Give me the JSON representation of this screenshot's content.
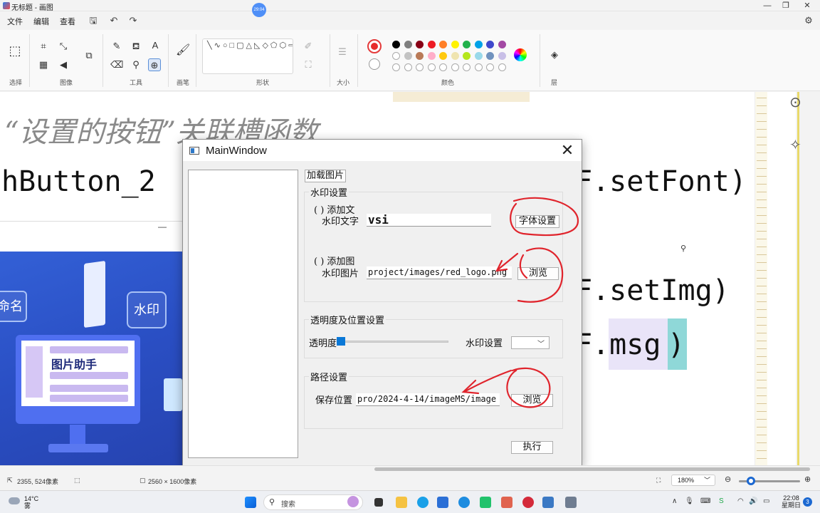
{
  "paint": {
    "title": "无标题 - 画图",
    "badge": "29:04",
    "menus": [
      "文件",
      "编辑",
      "查看"
    ],
    "groups": {
      "select": "选择",
      "image": "图像",
      "tools": "工具",
      "brush": "画笔",
      "shapes": "形状",
      "size": "大小",
      "colors": "颜色",
      "layers": "层"
    },
    "shapes_glyphs": "╲∿○□▢△◺◇⬠⬡⇨⇦⇧⇩✧☆✡▭◯◌♡☇",
    "palette": [
      "#000000",
      "#7f7f7f",
      "#880015",
      "#ed1c24",
      "#ff7f27",
      "#fff200",
      "#22b14c",
      "#00a2e8",
      "#3f48cc",
      "#a349a4",
      "#ffffff",
      "#c3c3c3",
      "#b97a57",
      "#ffaec9",
      "#ffc90e",
      "#efe4b0",
      "#b5e61d",
      "#99d9ea",
      "#7092be",
      "#c8bfe7"
    ],
    "current_color": "#e72b2b",
    "status": {
      "cursor_pos": "2355, 524像素",
      "image_size": "2560 × 1600像素",
      "zoom": "180%"
    }
  },
  "canvas": {
    "italic_text": "“设置的按钮”关联槽函数",
    "code_left": "hButton_2",
    "code_r1": "F.setFont)",
    "code_r2": "F.setImg)",
    "code_r3": "F.msg",
    "code_r3_close": ")"
  },
  "promo": {
    "rename": "命名",
    "watermark": "水印",
    "helper": "图片助手"
  },
  "mainwindow": {
    "title": "MainWindow",
    "close": "✕",
    "load_image_btn": "加载图片",
    "watermark_group": "水印设置",
    "add_text_radio": "( ) 添加文",
    "watermark_text_label": "水印文字",
    "watermark_text_value": "vsi",
    "font_settings_btn": "字体设置",
    "add_image_radio": "( ) 添加图",
    "watermark_image_label": "水印图片",
    "watermark_image_value": "project/images/red_logo.png",
    "browse_btn": "浏览",
    "opacity_group": "透明度及位置设置",
    "opacity_label": "透明度",
    "position_label": "水印设置",
    "combo_arrow": "﹀",
    "path_group": "路径设置",
    "save_location_label": "保存位置",
    "save_location_value": "pro/2024-4-14/imageMS/image",
    "browse_btn2": "浏览",
    "execute_btn": "执行"
  },
  "taskbar": {
    "temp": "14°C",
    "weather": "雾",
    "search_placeholder": "搜索",
    "time": "22:08",
    "day": "星期日",
    "notifications": "3"
  }
}
